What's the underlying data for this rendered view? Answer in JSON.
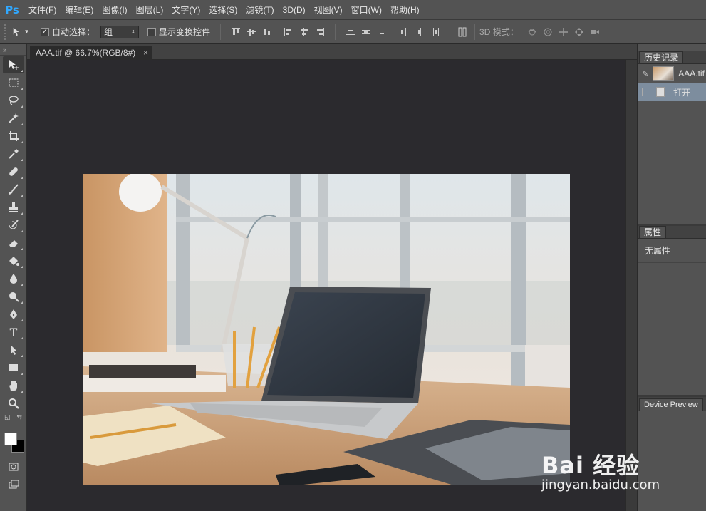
{
  "app": {
    "logo": "Ps"
  },
  "menu": [
    "文件(F)",
    "编辑(E)",
    "图像(I)",
    "图层(L)",
    "文字(Y)",
    "选择(S)",
    "滤镜(T)",
    "3D(D)",
    "视图(V)",
    "窗口(W)",
    "帮助(H)"
  ],
  "options": {
    "auto_select_label": "自动选择：",
    "auto_select_checked": true,
    "auto_select_value": "组",
    "show_transform_label": "显示变换控件",
    "show_transform_checked": false,
    "mode_3d_label": "3D 模式："
  },
  "document": {
    "tab_title": "AAA.tif @ 66.7%(RGB/8#)",
    "close_glyph": "×"
  },
  "panels": {
    "history": {
      "tab": "历史记录",
      "snapshot_name": "AAA.tif",
      "step": "打开"
    },
    "properties": {
      "tab": "属性",
      "empty_text": "无属性"
    },
    "device_preview": {
      "tab": "Device Preview"
    }
  },
  "tools": [
    "move-tool",
    "marquee-tool",
    "lasso-tool",
    "magic-wand-tool",
    "crop-tool",
    "eyedropper-tool",
    "healing-brush-tool",
    "brush-tool",
    "clone-stamp-tool",
    "history-brush-tool",
    "eraser-tool",
    "paint-bucket-tool",
    "blur-tool",
    "dodge-tool",
    "pen-tool",
    "type-tool",
    "path-selection-tool",
    "rectangle-tool",
    "hand-tool",
    "zoom-tool"
  ],
  "colors": {
    "foreground": "#ffffff",
    "background": "#000000"
  },
  "watermark": {
    "logo": "Bai 经验",
    "url": "jingyan.baidu.com"
  }
}
